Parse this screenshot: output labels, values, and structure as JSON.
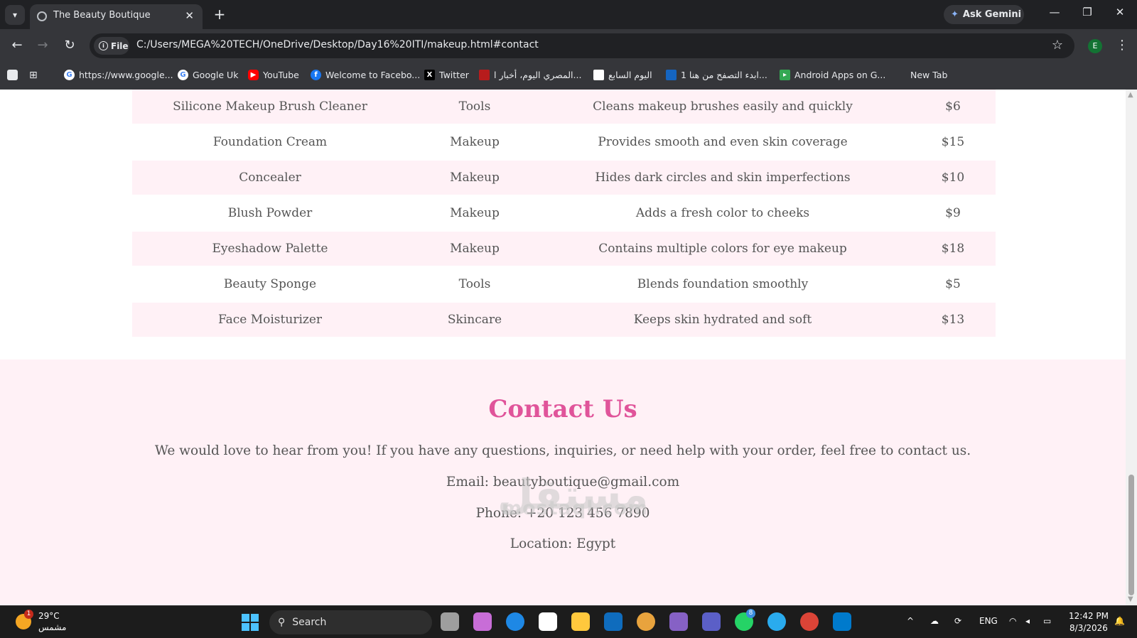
{
  "browser": {
    "tab_title": "The Beauty Boutique",
    "url": "C:/Users/MEGA%20TECH/OneDrive/Desktop/Day16%20ITI/makeup.html#contact",
    "chip_label": "File",
    "gemini_label": "Ask Gemini",
    "profile_initial": "E",
    "bookmarks": [
      {
        "label": "https://www.google...",
        "icon": "google-icon",
        "color": "#4285f4"
      },
      {
        "label": "Google Uk",
        "icon": "google-icon",
        "color": "#4285f4"
      },
      {
        "label": "YouTube",
        "icon": "youtube-icon",
        "color": "#ff0000"
      },
      {
        "label": "Welcome to Facebo...",
        "icon": "facebook-icon",
        "color": "#1877f2"
      },
      {
        "label": "Twitter",
        "icon": "x-icon",
        "color": "#000000"
      },
      {
        "label": "المصري اليوم، أخبار ا...",
        "icon": "news-icon",
        "color": "#b71c1c"
      },
      {
        "label": "اليوم السابع",
        "icon": "news-icon",
        "color": "#ffffff"
      },
      {
        "label": "ابدء التصفح من هنا 1...",
        "icon": "site-icon",
        "color": "#1565c0"
      },
      {
        "label": "Android Apps on G...",
        "icon": "play-icon",
        "color": "#34a853"
      },
      {
        "label": "New Tab",
        "icon": "newtab-icon",
        "color": "#35363a"
      }
    ]
  },
  "products": [
    {
      "name": "Silicone Makeup Brush Cleaner",
      "category": "Tools",
      "description": "Cleans makeup brushes easily and quickly",
      "price": "$6"
    },
    {
      "name": "Foundation Cream",
      "category": "Makeup",
      "description": "Provides smooth and even skin coverage",
      "price": "$15"
    },
    {
      "name": "Concealer",
      "category": "Makeup",
      "description": "Hides dark circles and skin imperfections",
      "price": "$10"
    },
    {
      "name": "Blush Powder",
      "category": "Makeup",
      "description": "Adds a fresh color to cheeks",
      "price": "$9"
    },
    {
      "name": "Eyeshadow Palette",
      "category": "Makeup",
      "description": "Contains multiple colors for eye makeup",
      "price": "$18"
    },
    {
      "name": "Beauty Sponge",
      "category": "Tools",
      "description": "Blends foundation smoothly",
      "price": "$5"
    },
    {
      "name": "Face Moisturizer",
      "category": "Skincare",
      "description": "Keeps skin hydrated and soft",
      "price": "$13"
    }
  ],
  "contact": {
    "heading": "Contact Us",
    "intro": "We would love to hear from you! If you have any questions, inquiries, or need help with your order, feel free to contact us.",
    "email": "Email: beautyboutique@gmail.com",
    "phone": "Phone: +20 123 456 7890",
    "location": "Location: Egypt"
  },
  "watermark": {
    "arabic": "مستقل",
    "latin": "mostaql.com"
  },
  "taskbar": {
    "temperature": "29°C",
    "weather_label": "مشمس",
    "weather_badge": "1",
    "search_label": "Search",
    "language": "ENG",
    "time": "12:42 PM",
    "date": "8/3/2026",
    "whatsapp_badge": "8"
  },
  "colors": {
    "accent": "#e0549a",
    "row_shade": "#fff1f6"
  }
}
